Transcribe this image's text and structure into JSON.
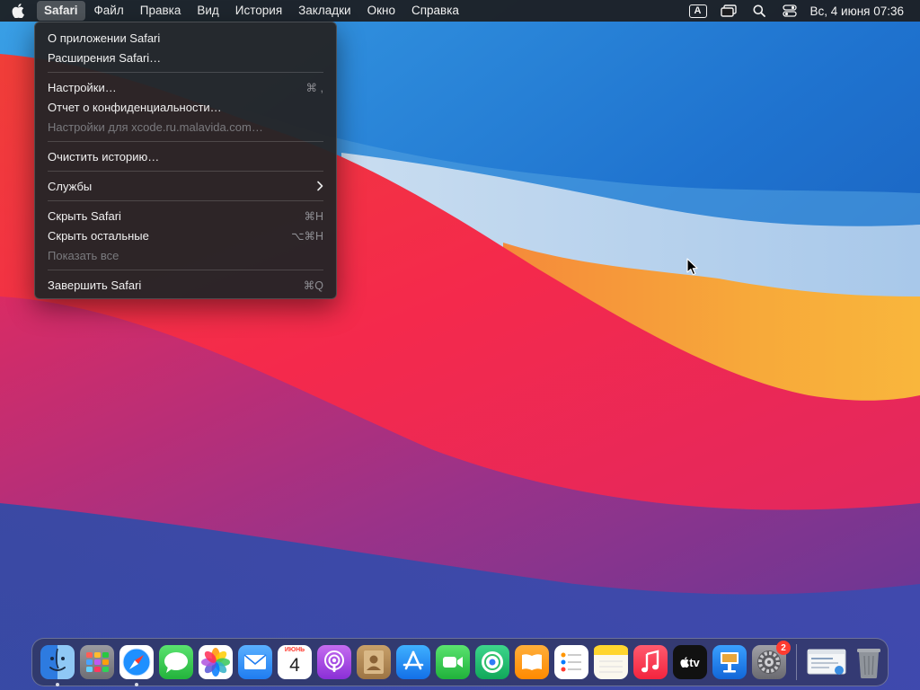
{
  "menubar": {
    "app_name": "Safari",
    "items": [
      "Файл",
      "Правка",
      "Вид",
      "История",
      "Закладки",
      "Окно",
      "Справка"
    ],
    "input_source": "A",
    "clock": "Вс, 4 июня  07:36"
  },
  "app_menu": {
    "groups": [
      [
        {
          "label": "О приложении Safari",
          "shortcut": "",
          "enabled": true
        },
        {
          "label": "Расширения Safari…",
          "shortcut": "",
          "enabled": true
        }
      ],
      [
        {
          "label": "Настройки…",
          "shortcut": "⌘ ,",
          "enabled": true
        },
        {
          "label": "Отчет о конфиденциальности…",
          "shortcut": "",
          "enabled": true
        },
        {
          "label": "Настройки для xcode.ru.malavida.com…",
          "shortcut": "",
          "enabled": false
        }
      ],
      [
        {
          "label": "Очистить историю…",
          "shortcut": "",
          "enabled": true
        }
      ],
      [
        {
          "label": "Службы",
          "shortcut": "",
          "enabled": true,
          "submenu": true
        }
      ],
      [
        {
          "label": "Скрыть Safari",
          "shortcut": "⌘H",
          "enabled": true
        },
        {
          "label": "Скрыть остальные",
          "shortcut": "⌥⌘H",
          "enabled": true
        },
        {
          "label": "Показать все",
          "shortcut": "",
          "enabled": false
        }
      ],
      [
        {
          "label": "Завершить Safari",
          "shortcut": "⌘Q",
          "enabled": true
        }
      ]
    ]
  },
  "dock": {
    "calendar": {
      "month": "ИЮНЬ",
      "day": "4"
    },
    "tv_label": "tv",
    "settings_badge": "2",
    "apps": [
      {
        "name": "finder",
        "color": "#3a8ff0",
        "running": true
      },
      {
        "name": "launchpad",
        "color": "#8d8d93",
        "running": false
      },
      {
        "name": "safari",
        "color": "#ffffff",
        "running": true
      },
      {
        "name": "messages",
        "color": "#34c759",
        "running": false
      },
      {
        "name": "photos",
        "color": "#ffffff",
        "running": false
      },
      {
        "name": "mail",
        "color": "#2f8ef4",
        "running": false
      },
      {
        "name": "calendar",
        "color": "#ffffff",
        "running": false
      },
      {
        "name": "podcasts",
        "color": "#9c4fe0",
        "running": false
      },
      {
        "name": "contacts",
        "color": "#b08a5a",
        "running": false
      },
      {
        "name": "app-store",
        "color": "#1e8cf5",
        "running": false
      },
      {
        "name": "facetime",
        "color": "#2fc24f",
        "running": false
      },
      {
        "name": "find-my",
        "color": "#34c759",
        "running": false
      },
      {
        "name": "books",
        "color": "#ff9500",
        "running": false
      },
      {
        "name": "reminders",
        "color": "#ffffff",
        "running": false
      },
      {
        "name": "notes",
        "color": "#fff3b0",
        "running": false
      },
      {
        "name": "music",
        "color": "#fa3553",
        "running": false
      },
      {
        "name": "tv",
        "color": "#111111",
        "running": false
      },
      {
        "name": "keynote",
        "color": "#1b86f2",
        "running": false
      },
      {
        "name": "system-preferences",
        "color": "#8e8e93",
        "running": false
      }
    ]
  }
}
